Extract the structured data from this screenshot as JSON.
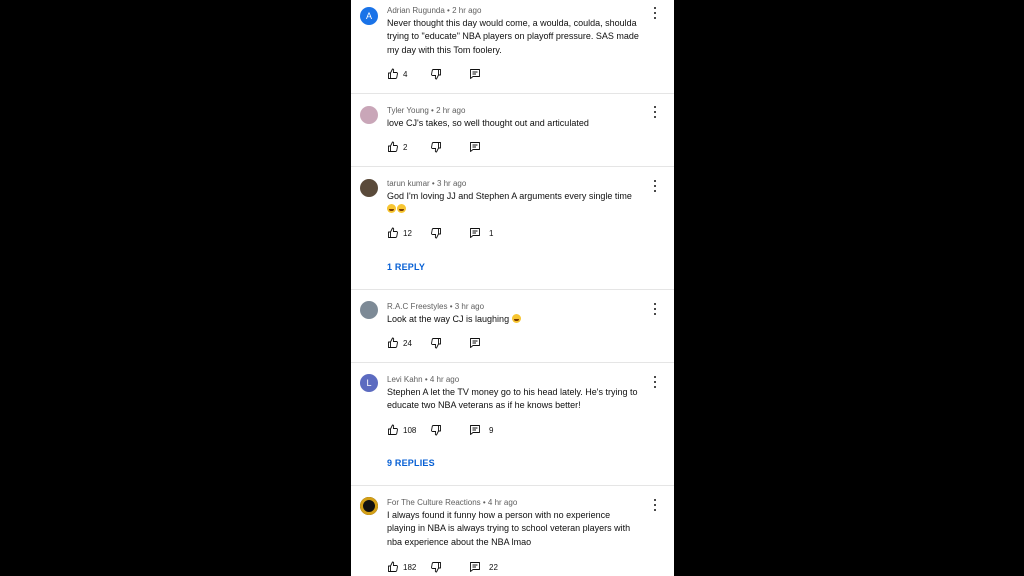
{
  "colors": {
    "link": "#065fd4",
    "text": "#0f0f0f",
    "meta": "#606060"
  },
  "comments": [
    {
      "author": "Adrian Rugunda",
      "time": "2 hr ago",
      "avatar": {
        "letter": "A",
        "color": "#1a73e8"
      },
      "lines": [
        "Never thought this day would come, a woulda, coulda, shoulda",
        "trying to \"educate\" NBA players on playoff pressure. SAS made",
        "my day with this Tom foolery."
      ],
      "likes": "4",
      "replies_count": ""
    },
    {
      "author": "Tyler Young",
      "time": "2 hr ago",
      "avatar": {
        "letter": "",
        "color": "#c9a6b8"
      },
      "lines": [
        "love CJ's takes, so well thought out and articulated"
      ],
      "likes": "2",
      "replies_count": ""
    },
    {
      "author": "tarun kumar",
      "time": "3 hr ago",
      "avatar": {
        "letter": "",
        "color": "#5a4a3a"
      },
      "lines": [
        "God I'm loving JJ and Stephen A arguments every single time"
      ],
      "emoji_line": "😂😂",
      "likes": "12",
      "replies_count": "1",
      "replies_link": "1 REPLY"
    },
    {
      "author": "R.A.C Freestyles",
      "time": "3 hr ago",
      "avatar": {
        "letter": "",
        "color": "#7d8a96"
      },
      "lines": [
        "Look at the way CJ is laughing"
      ],
      "inline_emoji": "😂",
      "likes": "24",
      "replies_count": ""
    },
    {
      "author": "Levi Kahn",
      "time": "4 hr ago",
      "avatar": {
        "letter": "L",
        "color": "#5c6bc0"
      },
      "lines": [
        "Stephen A let the TV money go to his head lately. He's trying to",
        "educate two NBA veterans as if he knows better!"
      ],
      "likes": "108",
      "replies_count": "9",
      "replies_link": "9 REPLIES"
    },
    {
      "author": "For The Culture Reactions",
      "time": "4 hr ago",
      "avatar": {
        "letter": "",
        "color": "#111111"
      },
      "lines": [
        "I always found it funny how a person with no experience",
        "playing in NBA is always trying to school veteran players with",
        "nba experience about the NBA lmao"
      ],
      "likes": "182",
      "replies_count": "22"
    }
  ]
}
